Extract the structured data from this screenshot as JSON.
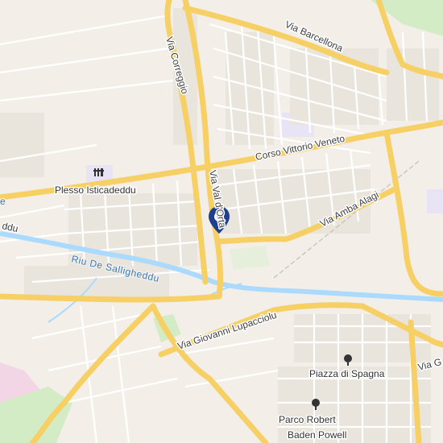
{
  "map": {
    "streets": {
      "via_barcellona": "Via Barcellona",
      "via_correggio": "Via Correggio",
      "corso_vittorio_veneto": "Corso Vittorio Veneto",
      "via_val_d_orta": "Via Val d'Orta",
      "via_amba_alagi": "Via Amba Alagi",
      "via_giovanni_lupacciolu": "Via Giovanni Lupacciolu",
      "via_g_cut": "Via G",
      "edge_cut_left": "ddu"
    },
    "water": {
      "river_name": "Riu De Salligheddu",
      "edge_cut_left": "e"
    },
    "pois": {
      "plesso": "Plesso Isticadeddu",
      "piazza": "Piazza di Spagna",
      "parco_line1": "Parco Robert",
      "parco_line2": "Baden Powell"
    },
    "colors": {
      "background": "#f3efe8",
      "major_road": "#f6cf65",
      "minor_road": "#ffffff",
      "water": "#aadaff",
      "park": "#cdeac0",
      "school": "#e8e3f5",
      "marker": "#1f3f8f",
      "poi_icon": "#333333"
    },
    "icons": {
      "marker": "location-pin-icon",
      "school": "school-icon",
      "park": "tree-icon"
    }
  }
}
